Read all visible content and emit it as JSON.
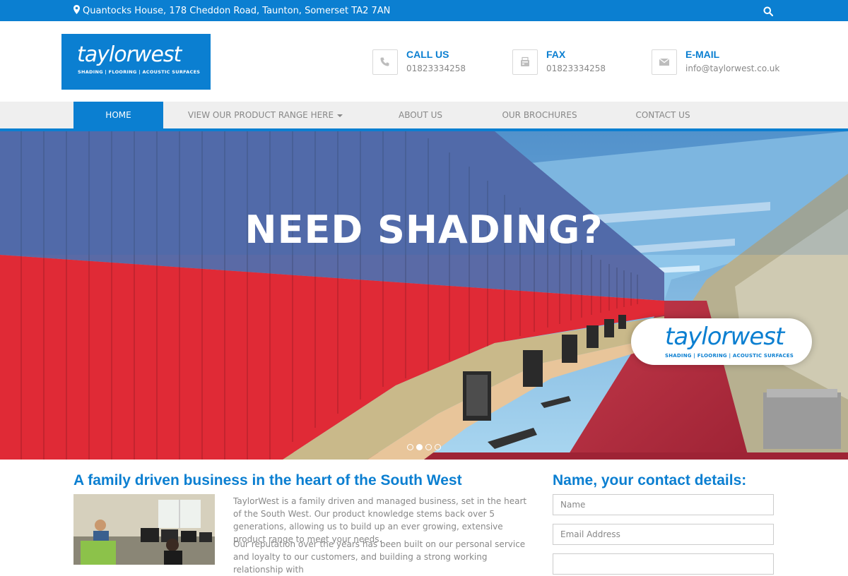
{
  "topbar": {
    "address": "Quantocks House, 178 Cheddon Road, Taunton, Somerset TA2 7AN",
    "icons": [
      "map-marker-icon",
      "search-icon"
    ]
  },
  "logo": {
    "wordmark": "taylorwest",
    "tagline": "SHADING | FLOORING | ACOUSTIC SURFACES"
  },
  "contacts": [
    {
      "title": "CALL US",
      "value": "01823334258",
      "icon": "phone-icon"
    },
    {
      "title": "FAX",
      "value": "01823334258",
      "icon": "fax-icon"
    },
    {
      "title": "E-MAIL",
      "value": "info@taylorwest.co.uk",
      "icon": "envelope-icon"
    }
  ],
  "nav": {
    "items": [
      "HOME",
      "VIEW OUR PRODUCT RANGE HERE",
      "ABOUT US",
      "OUR BROCHURES",
      "CONTACT US"
    ],
    "active": "HOME"
  },
  "hero": {
    "headline": "NEED SHADING?",
    "badge_wordmark": "taylorwest",
    "badge_tagline": "SHADING | FLOORING | ACOUSTIC SURFACES",
    "slides_total": 4,
    "active_slide": 2
  },
  "about": {
    "heading": "A family driven business in the heart of the South West",
    "para1": "TaylorWest is a family driven and managed business, set in the heart of the South West. Our product knowledge stems back over 5 generations, allowing us to build up an ever growing, extensive product range to meet your needs.",
    "para2": "Our reputation over the years has been built on our personal service and loyalty to our customers, and building a strong working relationship with"
  },
  "form": {
    "heading": "Name, your contact details:",
    "name_placeholder": "Name",
    "email_placeholder": "Email Address"
  },
  "colors": {
    "brand_blue": "#0b7fd1",
    "blind_red": "#e02a36",
    "nav_bg": "#efefef"
  }
}
